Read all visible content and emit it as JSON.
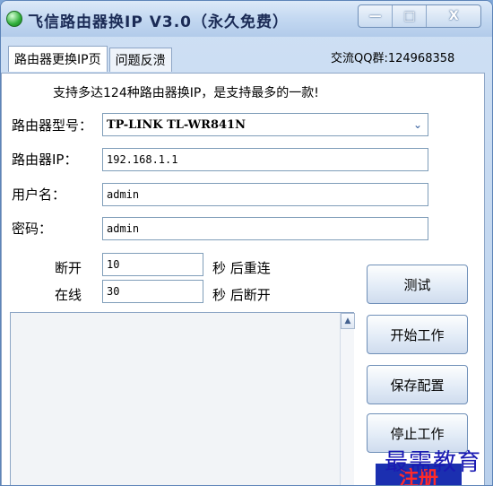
{
  "window": {
    "title": "飞信路由器换IP V3.0（永久免费）",
    "icon": "green-globe-icon",
    "controls": {
      "minimize_glyph": "—",
      "maximize_glyph": "□",
      "close_glyph": "X"
    }
  },
  "tabs": [
    {
      "label": "路由器更换IP页",
      "active": true
    },
    {
      "label": "问题反溃",
      "active": false
    }
  ],
  "qq_group": "交流QQ群:124968358",
  "notice": "支持多达124种路由器换IP，是支持最多的一款!",
  "form": {
    "model_label": "路由器型号：",
    "model_value": "TP-LINK TL-WR841N",
    "ip_label": "路由器IP：",
    "ip_value": "192.168.1.1",
    "user_label": "用户名：",
    "user_value": "admin",
    "pass_label": "密码：",
    "pass_value": "admin"
  },
  "timers": {
    "disconnect_label": "断开",
    "disconnect_value": "10",
    "disconnect_suffix": "秒 后重连",
    "online_label": "在线",
    "online_value": "30",
    "online_suffix": "秒 后断开"
  },
  "buttons": {
    "test": "测试",
    "start": "开始工作",
    "save": "保存配置",
    "stop": "停止工作"
  },
  "watermark": "最需教育",
  "stamp_text": "注册",
  "colors": {
    "accent": "#2f5a9a",
    "watermark": "#1a1ab3"
  }
}
